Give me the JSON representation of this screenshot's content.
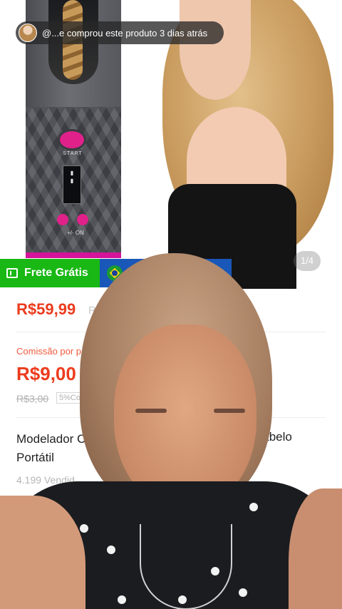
{
  "notification": {
    "text": "@...e comprou este produto 3 dias atrás"
  },
  "gallery": {
    "counter": "1/4",
    "curler_start_label": "START",
    "curler_pm_label": "+/-  ON"
  },
  "badges": {
    "free_shipping": "Frete Grátis",
    "free_shipping_icon": "ticket-icon",
    "origin_flag": "brazil-flag-icon"
  },
  "product": {
    "price": "R$59,99",
    "old_price_fragment": "R",
    "commission_label": "Comissão por p",
    "commission_value": "R$9,00",
    "commission_old": "R$3,00",
    "commission_pct": "5%Co",
    "title_part1": "Modelador C",
    "title_part2": "Cabelo",
    "title_line2": "Portátil",
    "sold": "4.199 Vendid"
  },
  "colors": {
    "price_red": "#ec3b1d",
    "free_shipping_green": "#19b814",
    "badge_blue": "#1957b8"
  }
}
